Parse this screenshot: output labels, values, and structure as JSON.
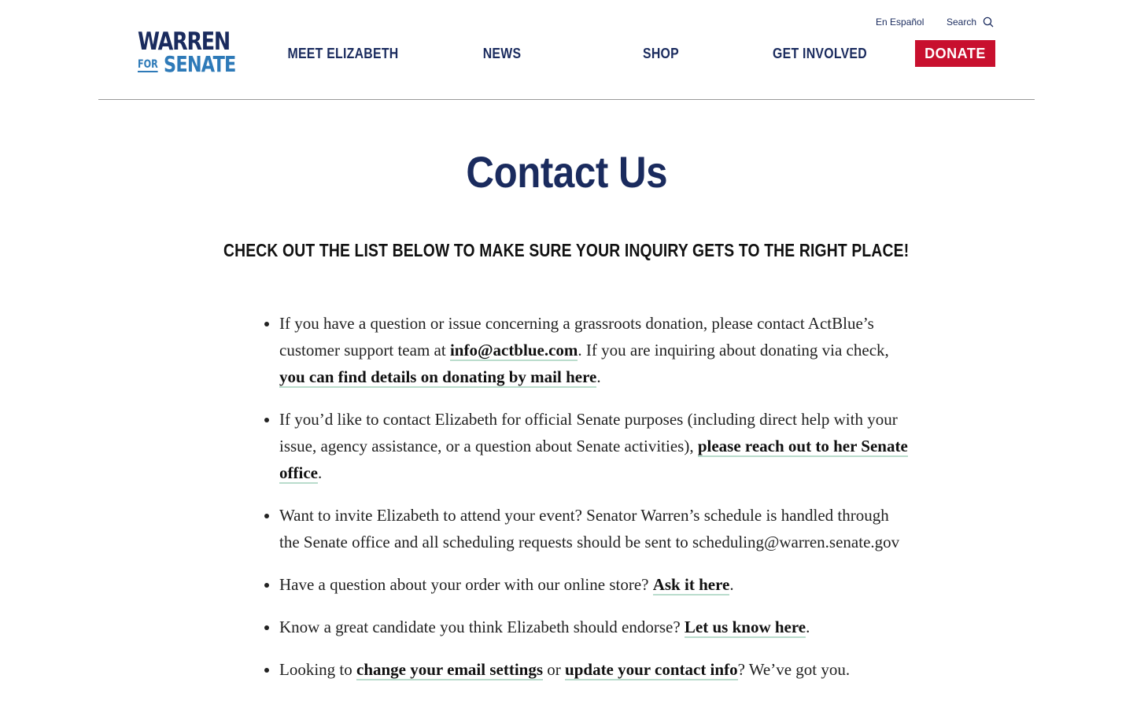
{
  "header": {
    "logo": {
      "line1": "WARREN",
      "line2_small": "FOR",
      "line2": "SENATE"
    },
    "nav": [
      "MEET ELIZABETH",
      "NEWS",
      "SHOP",
      "GET INVOLVED"
    ],
    "espanol": "En Español",
    "search": "Search",
    "donate": "DONATE"
  },
  "page": {
    "title": "Contact Us",
    "subhead": "CHECK OUT THE LIST BELOW TO MAKE SURE YOUR INQUIRY GETS TO THE RIGHT PLACE!"
  },
  "items": [
    {
      "t1": "If you have a question or issue concerning a grassroots donation, please contact ActBlue’s customer support team at ",
      "l1": "info@actblue.com",
      "t2": ". If you are inquiring about donating via check, ",
      "l2": "you can find details on donating by mail here",
      "t3": "."
    },
    {
      "t1": "If you’d like to contact Elizabeth for official Senate purposes (including direct help with your issue, agency assistance, or a question about Senate activities), ",
      "l1": "please reach out to her Senate office",
      "t2": "."
    },
    {
      "t1": "Want to invite Elizabeth to attend your event? Senator Warren’s schedule is handled through the Senate office and all scheduling requests should be sent to scheduling@warren.senate.gov"
    },
    {
      "t1": "Have a question about your order with our online store? ",
      "l1": "Ask it here",
      "t2": "."
    },
    {
      "t1": "Know a great candidate you think Elizabeth should endorse? ",
      "l1": "Let us know here",
      "t2": "."
    },
    {
      "t1": "Looking to ",
      "l1": "change your email settings",
      "t2": " or ",
      "l2": "update your contact info",
      "t3": "? We’ve got you."
    }
  ],
  "colors": {
    "navy": "#1a2b5e",
    "blue": "#2e7ab8",
    "red": "#c8102e",
    "link_underline": "#b9dccc"
  },
  "icons": {
    "search": "search-icon"
  }
}
